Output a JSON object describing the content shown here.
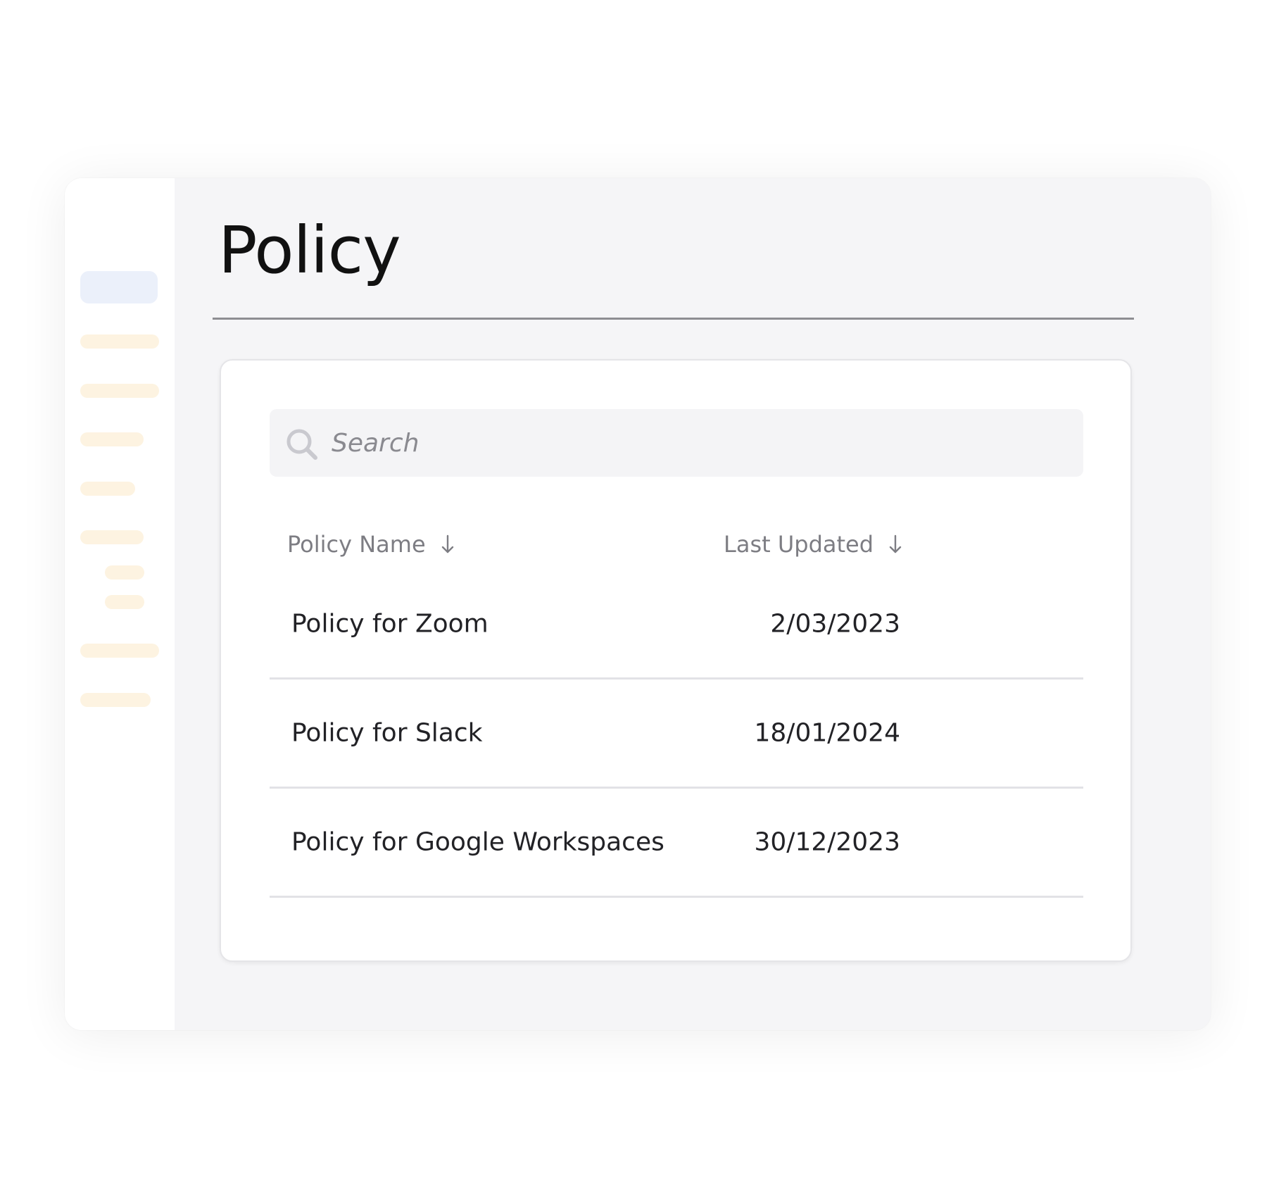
{
  "page": {
    "title": "Policy"
  },
  "search": {
    "placeholder": "Search",
    "value": "",
    "icon": "search-icon"
  },
  "table": {
    "columns": [
      {
        "label": "Policy Name",
        "sort_icon": "arrow-down-icon"
      },
      {
        "label": "Last Updated",
        "sort_icon": "arrow-down-icon"
      }
    ],
    "rows": [
      {
        "name": "Policy for Zoom",
        "updated": "2/03/2023"
      },
      {
        "name": "Policy for Slack",
        "updated": "18/01/2024"
      },
      {
        "name": "Policy for Google Workspaces",
        "updated": "30/12/2023"
      }
    ]
  },
  "colors": {
    "sidebar_active": "#ebf0fa",
    "sidebar_item": "#fdf3e1",
    "window_background": "#f5f5f7",
    "card_background": "#ffffff"
  }
}
